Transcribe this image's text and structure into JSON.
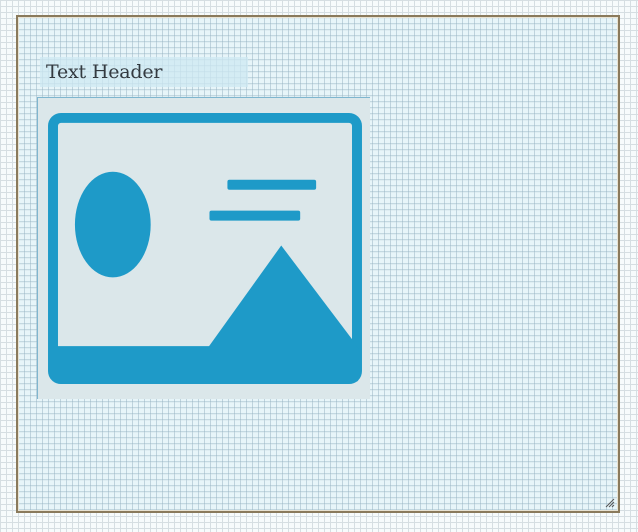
{
  "header": {
    "text": "Text Header"
  },
  "image_placeholder": {
    "icon": "image-placeholder-icon"
  },
  "colors": {
    "accent": "#1e9ac8",
    "image_bg": "#dbe7ea",
    "frame_border": "#8a7a5c"
  }
}
